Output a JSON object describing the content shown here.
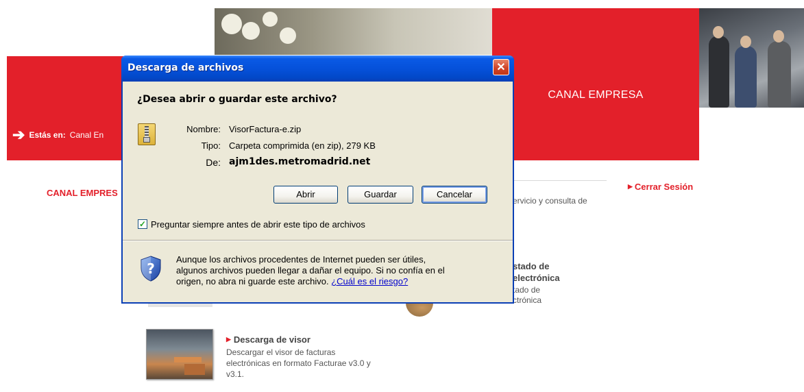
{
  "page": {
    "breadcrumb_prefix": "Estás en:",
    "breadcrumb_value": "Canal En",
    "canal_empresa_banner": "CANAL EMPRESA",
    "canal_empresa_left": "CANAL EMPRES",
    "servicio_text": "ervicio y consulta de",
    "cerrar_sesion": "Cerrar Sesión",
    "stado_title_line1": "stado de",
    "stado_title_line2": "electrónica",
    "stado_desc_line1": "tado de",
    "stado_desc_line2": "ctrónica",
    "visor_title": "Descarga de visor",
    "visor_desc": "Descargar el visor de facturas electrónicas en formato Facturae v3.0 y v3.1.",
    "accent_color": "#e3202a"
  },
  "dialog": {
    "title": "Descarga de archivos",
    "question": "¿Desea abrir o guardar este archivo?",
    "file": {
      "name_label": "Nombre:",
      "name_value": "VisorFactura-e.zip",
      "type_label": "Tipo:",
      "type_value": "Carpeta comprimida (en zip), 279 KB",
      "from_label": "De:",
      "from_value": "ajm1des.metromadrid.net",
      "icon": "zip-folder-icon"
    },
    "buttons": {
      "open": "Abrir",
      "save": "Guardar",
      "cancel": "Cancelar"
    },
    "always_ask": {
      "label": "Preguntar siempre antes de abrir este tipo de archivos",
      "checked": true
    },
    "warning": {
      "text": "Aunque los archivos procedentes de Internet pueden ser útiles, algunos archivos pueden llegar a dañar el equipo. Si no confía en el origen, no abra ni guarde este archivo.",
      "link": "¿Cuál es el riesgo?",
      "icon": "shield-question-icon"
    },
    "close_glyph": "✕"
  }
}
